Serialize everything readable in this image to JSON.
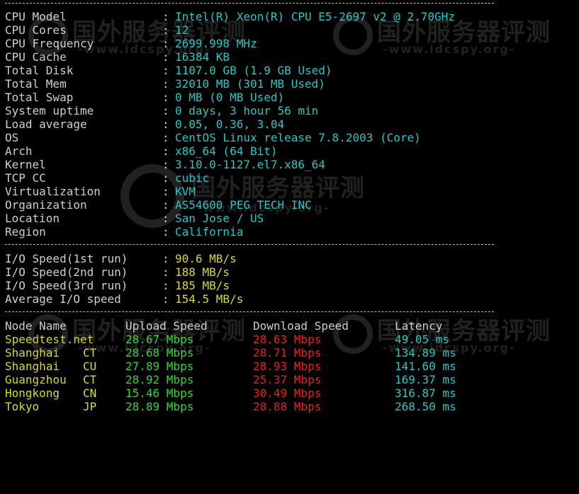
{
  "system_info": [
    {
      "label": "CPU Model",
      "value": "Intel(R) Xeon(R) CPU E5-2697 v2 @ 2.70GHz"
    },
    {
      "label": "CPU Cores",
      "value": "12"
    },
    {
      "label": "CPU Frequency",
      "value": "2699.998 MHz"
    },
    {
      "label": "CPU Cache",
      "value": "16384 KB"
    },
    {
      "label": "Total Disk",
      "value": "1107.0 GB (1.9 GB Used)"
    },
    {
      "label": "Total Mem",
      "value": "32010 MB (301 MB Used)"
    },
    {
      "label": "Total Swap",
      "value": "0 MB (0 MB Used)"
    },
    {
      "label": "System uptime",
      "value": "0 days, 3 hour 56 min"
    },
    {
      "label": "Load average",
      "value": "0.05, 0.36, 3.04"
    },
    {
      "label": "OS",
      "value": "CentOS Linux release 7.8.2003 (Core)"
    },
    {
      "label": "Arch",
      "value": "x86_64 (64 Bit)"
    },
    {
      "label": "Kernel",
      "value": "3.10.0-1127.el7.x86_64"
    },
    {
      "label": "TCP CC",
      "value": "cubic"
    },
    {
      "label": "Virtualization",
      "value": "KVM"
    },
    {
      "label": "Organization",
      "value": "AS54600 PEG TECH INC"
    },
    {
      "label": "Location",
      "value": "San Jose / US"
    },
    {
      "label": "Region",
      "value": "California"
    }
  ],
  "separator": ":",
  "io_speed": [
    {
      "label": "I/O Speed(1st run)",
      "value": "90.6 MB/s"
    },
    {
      "label": "I/O Speed(2nd run)",
      "value": "188 MB/s"
    },
    {
      "label": "I/O Speed(3rd run)",
      "value": "185 MB/s"
    },
    {
      "label": "Average I/O speed",
      "value": "154.5 MB/s"
    }
  ],
  "speed_table": {
    "headers": {
      "node": "Node Name",
      "upload": "Upload Speed",
      "download": "Download Speed",
      "latency": "Latency"
    },
    "rows": [
      {
        "node": "Speedtest.net",
        "cc": "",
        "upload": "28.67 Mbps",
        "download": "28.63 Mbps",
        "latency": "49.05 ms"
      },
      {
        "node": "Shanghai",
        "cc": "CT",
        "upload": "28.68 Mbps",
        "download": "28.71 Mbps",
        "latency": "134.89 ms"
      },
      {
        "node": "Shanghai",
        "cc": "CU",
        "upload": "27.89 Mbps",
        "download": "28.93 Mbps",
        "latency": "141.60 ms"
      },
      {
        "node": "Guangzhou",
        "cc": "CT",
        "upload": "28.92 Mbps",
        "download": "25.37 Mbps",
        "latency": "169.37 ms"
      },
      {
        "node": "Hongkong",
        "cc": "CN",
        "upload": "15.46 Mbps",
        "download": "30.49 Mbps",
        "latency": "316.87 ms"
      },
      {
        "node": "Tokyo",
        "cc": "JP",
        "upload": "28.89 Mbps",
        "download": "28.88 Mbps",
        "latency": "268.50 ms"
      }
    ]
  },
  "watermark": {
    "title": "国外服务器评测",
    "url": "-www.idcspy.org-"
  },
  "colors": {
    "background": "#000000",
    "label": "#c8c8c8",
    "info_value": "#27c7c7",
    "io_value": "#d9d92b",
    "upload": "#36d436",
    "download": "#e12222",
    "latency": "#27c7c7",
    "node": "#d9d92b"
  }
}
